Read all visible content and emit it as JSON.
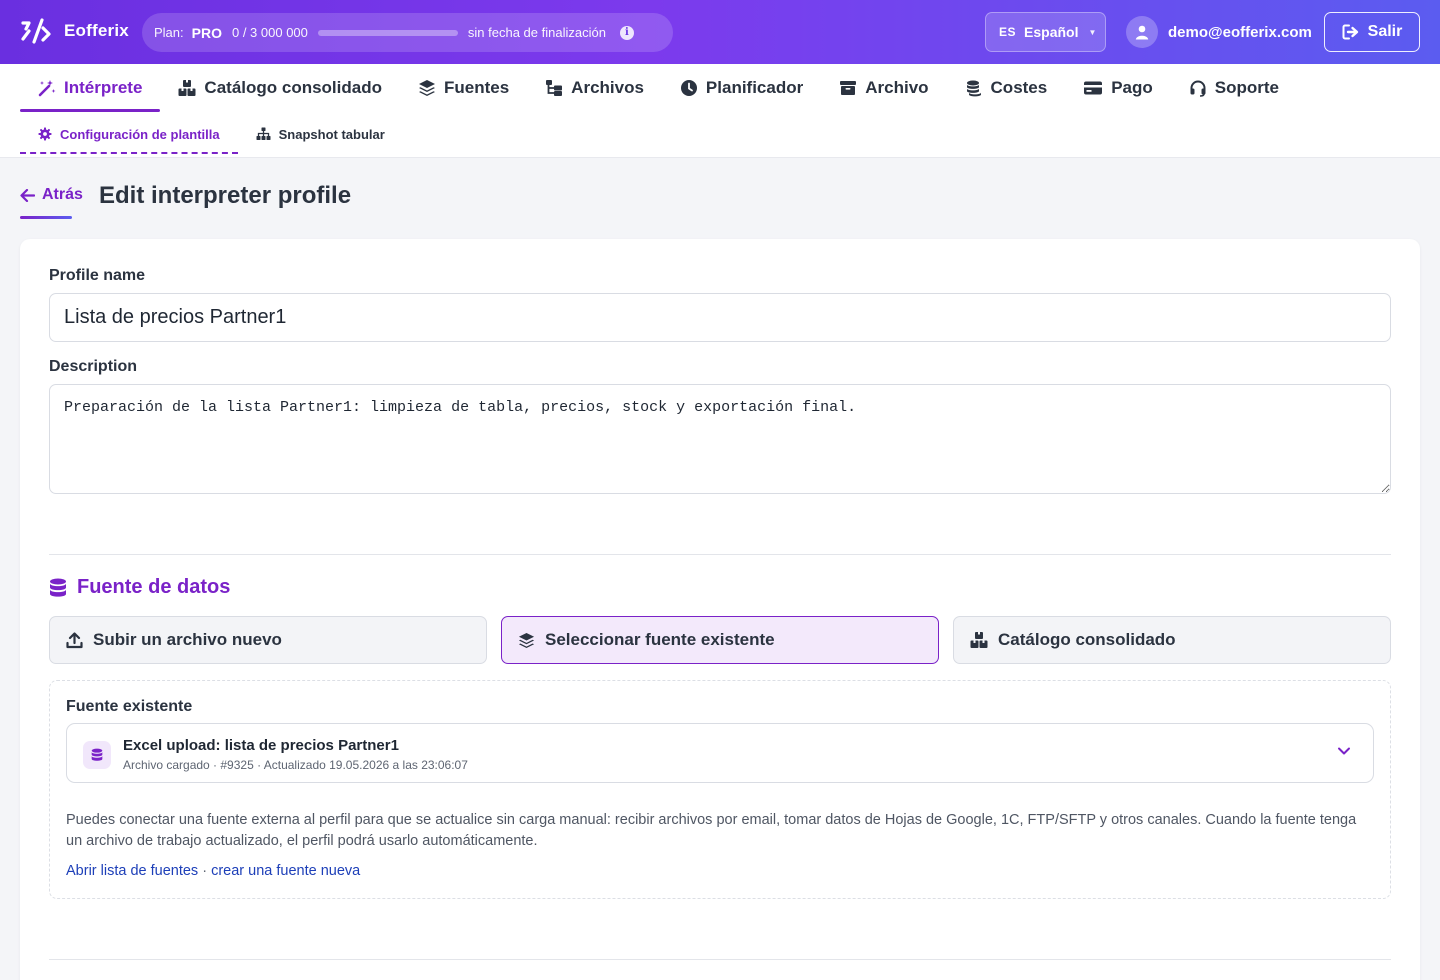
{
  "app": {
    "name": "Eofferix"
  },
  "plan": {
    "label": "Plan:",
    "tier": "PRO",
    "usage": "0 / 3 000 000",
    "usage_fraction": 0,
    "expiry": "sin fecha de finalización",
    "info_icon": "info-icon"
  },
  "language": {
    "code": "ES",
    "label": "Español"
  },
  "user": {
    "email": "demo@eofferix.com"
  },
  "logout": {
    "label": "Salir"
  },
  "nav": {
    "tabs": [
      {
        "label": "Intérprete",
        "icon": "magic-wand-icon",
        "active": true
      },
      {
        "label": "Catálogo consolidado",
        "icon": "boxes-icon"
      },
      {
        "label": "Fuentes",
        "icon": "layers-icon"
      },
      {
        "label": "Archivos",
        "icon": "folder-tree-icon"
      },
      {
        "label": "Planificador",
        "icon": "clock-icon"
      },
      {
        "label": "Archivo",
        "icon": "archive-box-icon"
      },
      {
        "label": "Costes",
        "icon": "coins-icon"
      },
      {
        "label": "Pago",
        "icon": "credit-card-icon"
      },
      {
        "label": "Soporte",
        "icon": "headset-icon"
      }
    ],
    "subtabs": [
      {
        "label": "Configuración de plantilla",
        "icon": "gear-icon",
        "active": true
      },
      {
        "label": "Snapshot tabular",
        "icon": "sitemap-icon"
      }
    ]
  },
  "page": {
    "back_label": "Atrás",
    "title": "Edit interpreter profile"
  },
  "form": {
    "profile_name_label": "Profile name",
    "profile_name_value": "Lista de precios Partner1",
    "description_label": "Description",
    "description_value": "Preparación de la lista Partner1: limpieza de tabla, precios, stock y exportación final."
  },
  "data_source": {
    "title": "Fuente de datos",
    "options": [
      {
        "label": "Subir un archivo nuevo",
        "icon": "upload-icon"
      },
      {
        "label": "Seleccionar fuente existente",
        "icon": "layers-icon",
        "active": true
      },
      {
        "label": "Catálogo consolidado",
        "icon": "boxes-icon"
      }
    ],
    "existing": {
      "title": "Fuente existente",
      "selected_name": "Excel upload: lista de precios Partner1",
      "selected_meta": "Archivo cargado · #9325 · Actualizado 19.05.2026 a las 23:06:07",
      "help_text": "Puedes conectar una fuente externa al perfil para que se actualice sin carga manual: recibir archivos por email, tomar datos de Hojas de Google, 1C, FTP/SFTP y otros canales. Cuando la fuente tenga un archivo de trabajo actualizado, el perfil podrá usarlo automáticamente.",
      "link_open": "Abrir lista de fuentes",
      "link_separator": "·",
      "link_create": "crear una fuente nueva"
    }
  },
  "colors": {
    "accent": "#7a22c8",
    "header_start": "#6a2fe0",
    "header_end": "#5b5cf0",
    "link": "#1d3fb8"
  }
}
